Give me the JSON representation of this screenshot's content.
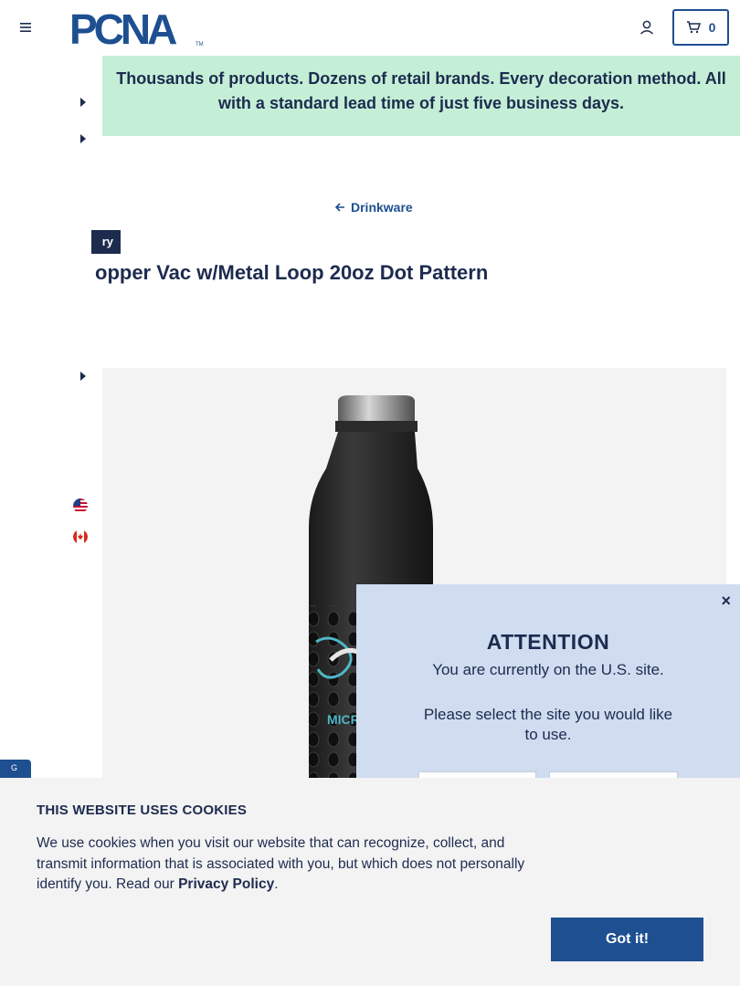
{
  "header": {
    "logo_text": "PCNA",
    "logo_tm": "TM",
    "cart_count": "0"
  },
  "banner": {
    "text": "Thousands of products. Dozens of retail brands. Every decoration method. All with a standard lead time of just five business days."
  },
  "breadcrumb": {
    "label": "Drinkware"
  },
  "product": {
    "category_tag": "ry",
    "title": "opper Vac w/Metal Loop 20oz Dot Pattern"
  },
  "flags": [
    "us-flag",
    "canada-flag"
  ],
  "attention_modal": {
    "title": "ATTENTION",
    "line1": "You are currently on the U.S. site.",
    "line2": "Please select the site you would like to use.",
    "close": "×"
  },
  "google_tab": "G",
  "cookie_banner": {
    "title": "THIS WEBSITE USES COOKIES",
    "body": "We use cookies when you visit our website that can recognize, collect, and transmit information that is associated with you, but which does not personally identify you. Read our ",
    "link": "Privacy Policy",
    "period": ".",
    "button": "Got it!"
  },
  "colors": {
    "brand_blue": "#1d4f91",
    "navy": "#1d2b4f",
    "banner_green": "#c4efd6",
    "modal_blue": "#d0dcef"
  }
}
